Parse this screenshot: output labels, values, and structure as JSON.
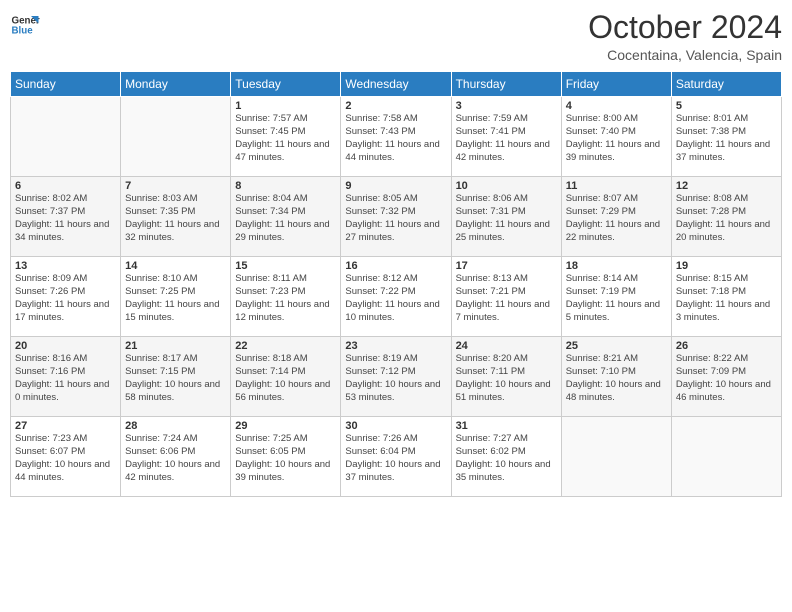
{
  "logo": {
    "line1": "General",
    "line2": "Blue"
  },
  "title": "October 2024",
  "location": "Cocentaina, Valencia, Spain",
  "headers": [
    "Sunday",
    "Monday",
    "Tuesday",
    "Wednesday",
    "Thursday",
    "Friday",
    "Saturday"
  ],
  "weeks": [
    [
      {
        "day": "",
        "info": ""
      },
      {
        "day": "",
        "info": ""
      },
      {
        "day": "1",
        "info": "Sunrise: 7:57 AM\nSunset: 7:45 PM\nDaylight: 11 hours and 47 minutes."
      },
      {
        "day": "2",
        "info": "Sunrise: 7:58 AM\nSunset: 7:43 PM\nDaylight: 11 hours and 44 minutes."
      },
      {
        "day": "3",
        "info": "Sunrise: 7:59 AM\nSunset: 7:41 PM\nDaylight: 11 hours and 42 minutes."
      },
      {
        "day": "4",
        "info": "Sunrise: 8:00 AM\nSunset: 7:40 PM\nDaylight: 11 hours and 39 minutes."
      },
      {
        "day": "5",
        "info": "Sunrise: 8:01 AM\nSunset: 7:38 PM\nDaylight: 11 hours and 37 minutes."
      }
    ],
    [
      {
        "day": "6",
        "info": "Sunrise: 8:02 AM\nSunset: 7:37 PM\nDaylight: 11 hours and 34 minutes."
      },
      {
        "day": "7",
        "info": "Sunrise: 8:03 AM\nSunset: 7:35 PM\nDaylight: 11 hours and 32 minutes."
      },
      {
        "day": "8",
        "info": "Sunrise: 8:04 AM\nSunset: 7:34 PM\nDaylight: 11 hours and 29 minutes."
      },
      {
        "day": "9",
        "info": "Sunrise: 8:05 AM\nSunset: 7:32 PM\nDaylight: 11 hours and 27 minutes."
      },
      {
        "day": "10",
        "info": "Sunrise: 8:06 AM\nSunset: 7:31 PM\nDaylight: 11 hours and 25 minutes."
      },
      {
        "day": "11",
        "info": "Sunrise: 8:07 AM\nSunset: 7:29 PM\nDaylight: 11 hours and 22 minutes."
      },
      {
        "day": "12",
        "info": "Sunrise: 8:08 AM\nSunset: 7:28 PM\nDaylight: 11 hours and 20 minutes."
      }
    ],
    [
      {
        "day": "13",
        "info": "Sunrise: 8:09 AM\nSunset: 7:26 PM\nDaylight: 11 hours and 17 minutes."
      },
      {
        "day": "14",
        "info": "Sunrise: 8:10 AM\nSunset: 7:25 PM\nDaylight: 11 hours and 15 minutes."
      },
      {
        "day": "15",
        "info": "Sunrise: 8:11 AM\nSunset: 7:23 PM\nDaylight: 11 hours and 12 minutes."
      },
      {
        "day": "16",
        "info": "Sunrise: 8:12 AM\nSunset: 7:22 PM\nDaylight: 11 hours and 10 minutes."
      },
      {
        "day": "17",
        "info": "Sunrise: 8:13 AM\nSunset: 7:21 PM\nDaylight: 11 hours and 7 minutes."
      },
      {
        "day": "18",
        "info": "Sunrise: 8:14 AM\nSunset: 7:19 PM\nDaylight: 11 hours and 5 minutes."
      },
      {
        "day": "19",
        "info": "Sunrise: 8:15 AM\nSunset: 7:18 PM\nDaylight: 11 hours and 3 minutes."
      }
    ],
    [
      {
        "day": "20",
        "info": "Sunrise: 8:16 AM\nSunset: 7:16 PM\nDaylight: 11 hours and 0 minutes."
      },
      {
        "day": "21",
        "info": "Sunrise: 8:17 AM\nSunset: 7:15 PM\nDaylight: 10 hours and 58 minutes."
      },
      {
        "day": "22",
        "info": "Sunrise: 8:18 AM\nSunset: 7:14 PM\nDaylight: 10 hours and 56 minutes."
      },
      {
        "day": "23",
        "info": "Sunrise: 8:19 AM\nSunset: 7:12 PM\nDaylight: 10 hours and 53 minutes."
      },
      {
        "day": "24",
        "info": "Sunrise: 8:20 AM\nSunset: 7:11 PM\nDaylight: 10 hours and 51 minutes."
      },
      {
        "day": "25",
        "info": "Sunrise: 8:21 AM\nSunset: 7:10 PM\nDaylight: 10 hours and 48 minutes."
      },
      {
        "day": "26",
        "info": "Sunrise: 8:22 AM\nSunset: 7:09 PM\nDaylight: 10 hours and 46 minutes."
      }
    ],
    [
      {
        "day": "27",
        "info": "Sunrise: 7:23 AM\nSunset: 6:07 PM\nDaylight: 10 hours and 44 minutes."
      },
      {
        "day": "28",
        "info": "Sunrise: 7:24 AM\nSunset: 6:06 PM\nDaylight: 10 hours and 42 minutes."
      },
      {
        "day": "29",
        "info": "Sunrise: 7:25 AM\nSunset: 6:05 PM\nDaylight: 10 hours and 39 minutes."
      },
      {
        "day": "30",
        "info": "Sunrise: 7:26 AM\nSunset: 6:04 PM\nDaylight: 10 hours and 37 minutes."
      },
      {
        "day": "31",
        "info": "Sunrise: 7:27 AM\nSunset: 6:02 PM\nDaylight: 10 hours and 35 minutes."
      },
      {
        "day": "",
        "info": ""
      },
      {
        "day": "",
        "info": ""
      }
    ]
  ]
}
